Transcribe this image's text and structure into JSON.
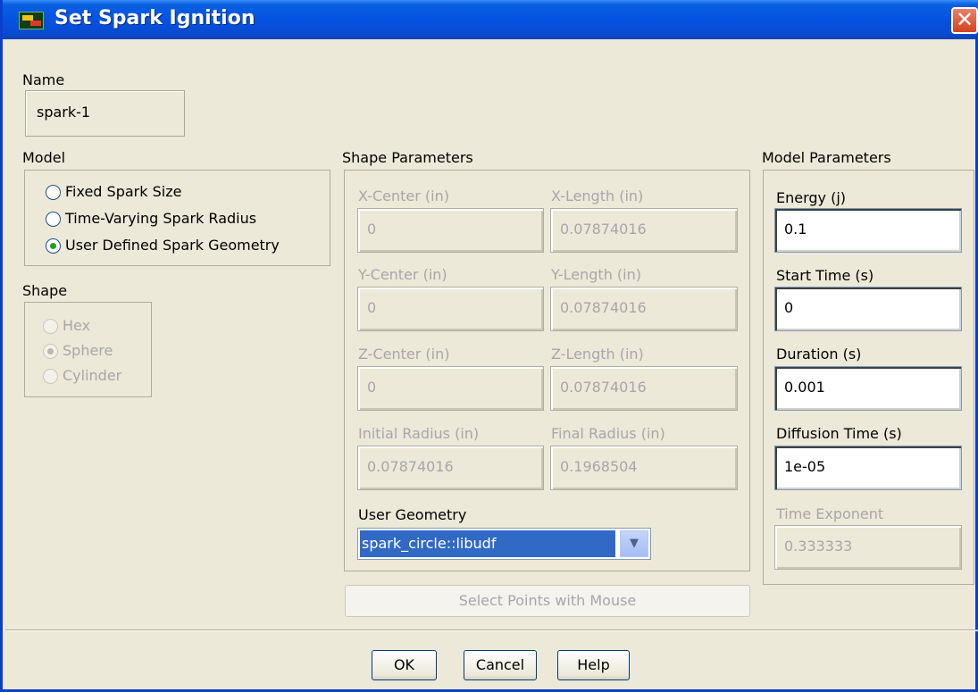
{
  "window": {
    "title": "Set Spark Ignition",
    "close_glyph": "✕"
  },
  "name": {
    "label": "Name",
    "value": "spark-1"
  },
  "model": {
    "label": "Model",
    "options": [
      "Fixed Spark Size",
      "Time-Varying Spark Radius",
      "User Defined Spark Geometry"
    ],
    "selected": "User Defined Spark Geometry"
  },
  "shape": {
    "label": "Shape",
    "options": [
      "Hex",
      "Sphere",
      "Cylinder"
    ],
    "selected": "Sphere"
  },
  "shape_parameters": {
    "label": "Shape Parameters",
    "x_center": {
      "label": "X-Center (in)",
      "value": "0"
    },
    "x_length": {
      "label": "X-Length (in)",
      "value": "0.07874016"
    },
    "y_center": {
      "label": "Y-Center (in)",
      "value": "0"
    },
    "y_length": {
      "label": "Y-Length (in)",
      "value": "0.07874016"
    },
    "z_center": {
      "label": "Z-Center (in)",
      "value": "0"
    },
    "z_length": {
      "label": "Z-Length (in)",
      "value": "0.07874016"
    },
    "initial_radius": {
      "label": "Initial Radius (in)",
      "value": "0.07874016"
    },
    "final_radius": {
      "label": "Final Radius (in)",
      "value": "0.1968504"
    },
    "user_geometry": {
      "label": "User Geometry",
      "value": "spark_circle::libudf"
    }
  },
  "model_parameters": {
    "label": "Model Parameters",
    "energy": {
      "label": "Energy (j)",
      "value": "0.1"
    },
    "start_time": {
      "label": "Start Time (s)",
      "value": "0"
    },
    "duration": {
      "label": "Duration (s)",
      "value": "0.001"
    },
    "diffusion_time": {
      "label": "Diffusion Time (s)",
      "value": "1e-05"
    },
    "time_exponent": {
      "label": "Time Exponent",
      "value": "0.333333"
    }
  },
  "select_points_label": "Select Points with Mouse",
  "buttons": {
    "ok": "OK",
    "cancel": "Cancel",
    "help": "Help"
  },
  "icons": {
    "app": "fluent-app-icon",
    "close": "close-icon",
    "dropdown": "chevron-down-icon"
  },
  "colors": {
    "title_bar": "#0554e3",
    "selection": "#316ac5",
    "disabled_text": "#a7a6aa"
  }
}
